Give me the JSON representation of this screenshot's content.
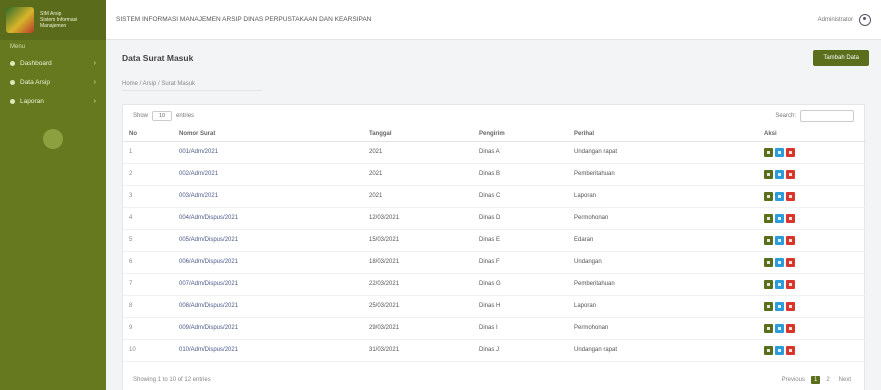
{
  "brand": {
    "name": "SIM Arsip",
    "subtitle": "Sistem Informasi Manajemen"
  },
  "sidebar": {
    "section_label": "Menu",
    "items": [
      {
        "label": "Dashboard"
      },
      {
        "label": "Data Arsip"
      },
      {
        "label": "Laporan"
      }
    ]
  },
  "topbar": {
    "app_title": "SISTEM INFORMASI MANAJEMEN ARSIP DINAS PERPUSTAKAAN DAN KEARSIPAN",
    "user_name": "Administrator"
  },
  "page": {
    "title": "Data Surat Masuk",
    "add_button": "Tambah Data",
    "breadcrumb": "Home / Arsip / Surat Masuk"
  },
  "table": {
    "length_label": "Show",
    "length_value": "10",
    "length_suffix": "entries",
    "search_label": "Search:",
    "search_value": "",
    "columns": [
      "No",
      "Nomor Surat",
      "Tanggal",
      "Pengirim",
      "Perihal",
      "Aksi"
    ],
    "rows": [
      {
        "no": "1",
        "nomor": "001/Adm/2021",
        "tanggal": "2021",
        "pengirim": "Dinas A",
        "perihal": "Undangan rapat"
      },
      {
        "no": "2",
        "nomor": "002/Adm/2021",
        "tanggal": "2021",
        "pengirim": "Dinas B",
        "perihal": "Pemberitahuan"
      },
      {
        "no": "3",
        "nomor": "003/Adm/2021",
        "tanggal": "2021",
        "pengirim": "Dinas C",
        "perihal": "Laporan"
      },
      {
        "no": "4",
        "nomor": "004/Adm/Dispus/2021",
        "tanggal": "12/03/2021",
        "pengirim": "Dinas D",
        "perihal": "Permohonan"
      },
      {
        "no": "5",
        "nomor": "005/Adm/Dispus/2021",
        "tanggal": "15/03/2021",
        "pengirim": "Dinas E",
        "perihal": "Edaran"
      },
      {
        "no": "6",
        "nomor": "006/Adm/Dispus/2021",
        "tanggal": "18/03/2021",
        "pengirim": "Dinas F",
        "perihal": "Undangan"
      },
      {
        "no": "7",
        "nomor": "007/Adm/Dispus/2021",
        "tanggal": "22/03/2021",
        "pengirim": "Dinas G",
        "perihal": "Pemberitahuan"
      },
      {
        "no": "8",
        "nomor": "008/Adm/Dispus/2021",
        "tanggal": "25/03/2021",
        "pengirim": "Dinas H",
        "perihal": "Laporan"
      },
      {
        "no": "9",
        "nomor": "009/Adm/Dispus/2021",
        "tanggal": "29/03/2021",
        "pengirim": "Dinas I",
        "perihal": "Permohonan"
      },
      {
        "no": "10",
        "nomor": "010/Adm/Dispus/2021",
        "tanggal": "31/03/2021",
        "pengirim": "Dinas J",
        "perihal": "Undangan rapat"
      }
    ]
  },
  "footer": {
    "info": "Showing 1 to 10 of 12 entries",
    "prev": "Previous",
    "pages": [
      "1",
      "2"
    ],
    "next": "Next"
  },
  "colors": {
    "sidebar": "#66791f",
    "primary": "#5a6e1c",
    "edit": "#2d9cdb",
    "delete": "#d9362b"
  }
}
